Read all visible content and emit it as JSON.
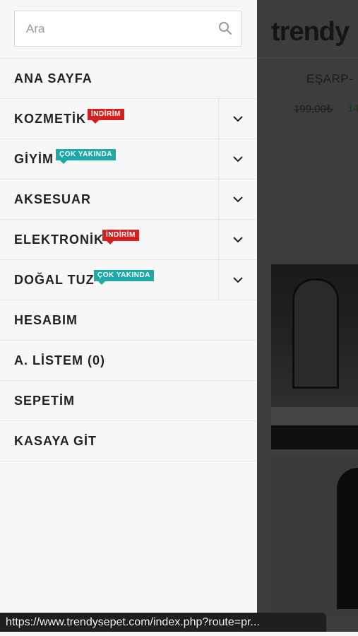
{
  "background": {
    "logo": "trendy",
    "product_title": "EŞARP-",
    "price_old": "199,00₺",
    "price_new": "14"
  },
  "search": {
    "placeholder": "Ara",
    "value": ""
  },
  "menu": {
    "items": [
      {
        "label": "ANA SAYFA"
      },
      {
        "label": "KOZMETİK",
        "badge": "İNDİRİM",
        "badge_color": "#d3201f"
      },
      {
        "label": "GİYİM",
        "badge": "ÇOK YAKINDA",
        "badge_color": "#1fa8a8"
      },
      {
        "label": "AKSESUAR"
      },
      {
        "label": "ELEKTRONİK",
        "badge": "İNDİRİM",
        "badge_color": "#d3201f"
      },
      {
        "label": "DOĞAL TUZ",
        "badge": "ÇOK YAKINDA",
        "badge_color": "#1fa8a8"
      },
      {
        "label": "HESABIM"
      },
      {
        "label": "A. LİSTEM (0)"
      },
      {
        "label": "SEPETİM"
      },
      {
        "label": "KASAYA GİT"
      }
    ]
  },
  "status_bar": {
    "url": "https://www.trendysepet.com/index.php?route=pr..."
  }
}
